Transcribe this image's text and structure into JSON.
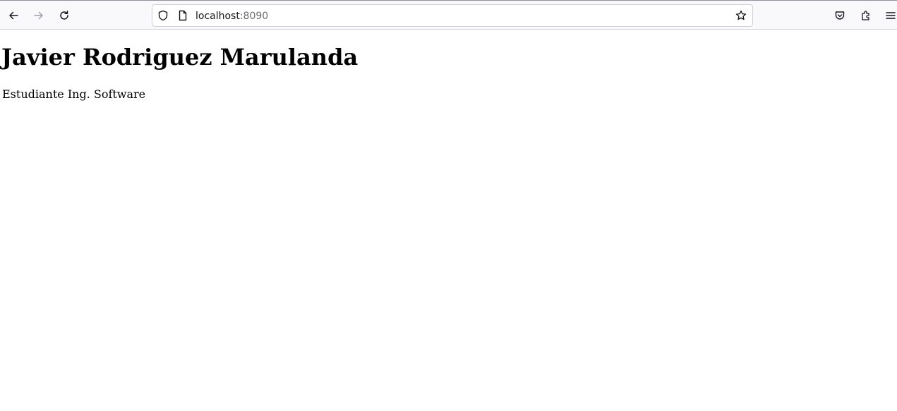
{
  "browser": {
    "url_host": "localhost",
    "url_port": ":8090",
    "icons": {
      "back": "back-arrow-icon",
      "forward": "forward-arrow-icon",
      "reload": "reload-icon",
      "shield": "tracking-protection-shield-icon",
      "page": "page-icon",
      "bookmark": "star-icon",
      "pocket": "pocket-icon",
      "extensions": "extensions-icon",
      "menu": "hamburger-menu-icon"
    }
  },
  "page": {
    "heading": "Javier Rodriguez Marulanda",
    "subtitle": "Estudiante Ing. Software"
  }
}
